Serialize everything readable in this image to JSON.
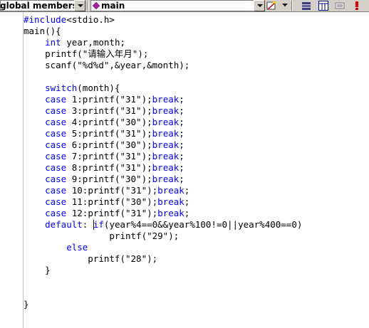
{
  "toolbar": {
    "scope_combo": "global members",
    "function_combo": "main",
    "icons": [
      "diamond-icon",
      "class-wizard-icon",
      "go-to-definition-icon",
      "properties-icon",
      "breakpoint-icon"
    ]
  },
  "editor": {
    "lines": [
      [
        {
          "t": "#include",
          "k": true
        },
        {
          "t": "<stdio.h>"
        }
      ],
      [
        {
          "t": "main(){"
        }
      ],
      [
        {
          "t": "    "
        },
        {
          "t": "int",
          "k": true
        },
        {
          "t": " year,month;"
        }
      ],
      [
        {
          "t": "    printf(\"请输入年月\");"
        }
      ],
      [
        {
          "t": "    scanf(\"%d%d\",&year,&month);"
        }
      ],
      [],
      [
        {
          "t": "    "
        },
        {
          "t": "switch",
          "k": true
        },
        {
          "t": "(month){"
        }
      ],
      [
        {
          "t": "    "
        },
        {
          "t": "case",
          "k": true
        },
        {
          "t": " 1:printf(\"31\");"
        },
        {
          "t": "break",
          "k": true
        },
        {
          "t": ";"
        }
      ],
      [
        {
          "t": "    "
        },
        {
          "t": "case",
          "k": true
        },
        {
          "t": " 3:printf(\"31\");"
        },
        {
          "t": "break",
          "k": true
        },
        {
          "t": ";"
        }
      ],
      [
        {
          "t": "    "
        },
        {
          "t": "case",
          "k": true
        },
        {
          "t": " 4:printf(\"30\");"
        },
        {
          "t": "break",
          "k": true
        },
        {
          "t": ";"
        }
      ],
      [
        {
          "t": "    "
        },
        {
          "t": "case",
          "k": true
        },
        {
          "t": " 5:printf(\"31\");"
        },
        {
          "t": "break",
          "k": true
        },
        {
          "t": ";"
        }
      ],
      [
        {
          "t": "    "
        },
        {
          "t": "case",
          "k": true
        },
        {
          "t": " 6:printf(\"30\");"
        },
        {
          "t": "break",
          "k": true
        },
        {
          "t": ";"
        }
      ],
      [
        {
          "t": "    "
        },
        {
          "t": "case",
          "k": true
        },
        {
          "t": " 7:printf(\"31\");"
        },
        {
          "t": "break",
          "k": true
        },
        {
          "t": ";"
        }
      ],
      [
        {
          "t": "    "
        },
        {
          "t": "case",
          "k": true
        },
        {
          "t": " 8:printf(\"31\");"
        },
        {
          "t": "break",
          "k": true
        },
        {
          "t": ";"
        }
      ],
      [
        {
          "t": "    "
        },
        {
          "t": "case",
          "k": true
        },
        {
          "t": " 9:printf(\"30\");"
        },
        {
          "t": "break",
          "k": true
        },
        {
          "t": ";"
        }
      ],
      [
        {
          "t": "    "
        },
        {
          "t": "case",
          "k": true
        },
        {
          "t": " 10:printf(\"31\");"
        },
        {
          "t": "break",
          "k": true
        },
        {
          "t": ";"
        }
      ],
      [
        {
          "t": "    "
        },
        {
          "t": "case",
          "k": true
        },
        {
          "t": " 11:printf(\"30\");"
        },
        {
          "t": "break",
          "k": true
        },
        {
          "t": ";"
        }
      ],
      [
        {
          "t": "    "
        },
        {
          "t": "case",
          "k": true
        },
        {
          "t": " 12:printf(\"31\");"
        },
        {
          "t": "break",
          "k": true
        },
        {
          "t": ";"
        }
      ],
      [
        {
          "t": "    "
        },
        {
          "t": "default",
          "k": true
        },
        {
          "t": ": "
        },
        {
          "t": "if",
          "k": true,
          "caret": true
        },
        {
          "t": "(year%4==0&&year%100!=0||year%400==0)"
        }
      ],
      [
        {
          "t": "                printf(\"29\");"
        }
      ],
      [
        {
          "t": "        "
        },
        {
          "t": "else",
          "k": true
        }
      ],
      [
        {
          "t": "            printf(\"28\");"
        }
      ],
      [
        {
          "t": "    }"
        }
      ],
      [],
      [],
      [
        {
          "t": "}"
        }
      ]
    ]
  },
  "colors": {
    "keyword": "#0000ff",
    "text": "#000000",
    "toolbar_bg": "#d4d0c8"
  }
}
